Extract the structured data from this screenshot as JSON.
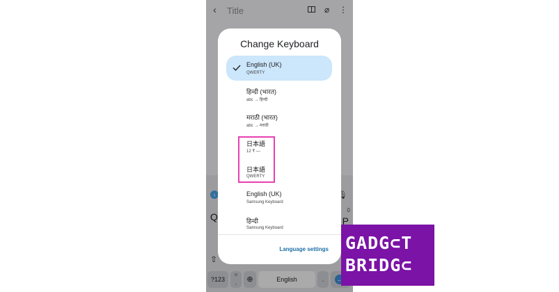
{
  "app": {
    "title_placeholder": "Title"
  },
  "keyboard": {
    "key_q": "Q",
    "key_p": "P",
    "key_zero": "0",
    "key_123": "?123",
    "key_space": "English",
    "key_period": "."
  },
  "dialog": {
    "title": "Change Keyboard",
    "options": [
      {
        "name": "English (UK)",
        "sub": "QWERTY",
        "selected": true
      },
      {
        "name": "हिन्दी (भारत)",
        "sub": "abc → हिन्दी",
        "selected": false
      },
      {
        "name": "मराठी (भारत)",
        "sub": "abc → मराठी",
        "selected": false
      },
      {
        "name": "日本語",
        "sub": "12 ₹ —",
        "selected": false
      },
      {
        "name": "日本語",
        "sub": "QWERTY",
        "selected": false
      },
      {
        "name": "English (UK)",
        "sub": "Samsung Keyboard",
        "selected": false
      },
      {
        "name": "हिन्दी",
        "sub": "Samsung Keyboard",
        "selected": false
      }
    ],
    "footer_link": "Language settings"
  },
  "colors": {
    "selected_bg": "#cce6fb",
    "highlight_border": "#e83fb2",
    "logo_bg": "#7a13a6",
    "link": "#1d6fa8"
  },
  "logo": {
    "line1": "GADG⊂T",
    "line2": "BRIDG⊂"
  }
}
